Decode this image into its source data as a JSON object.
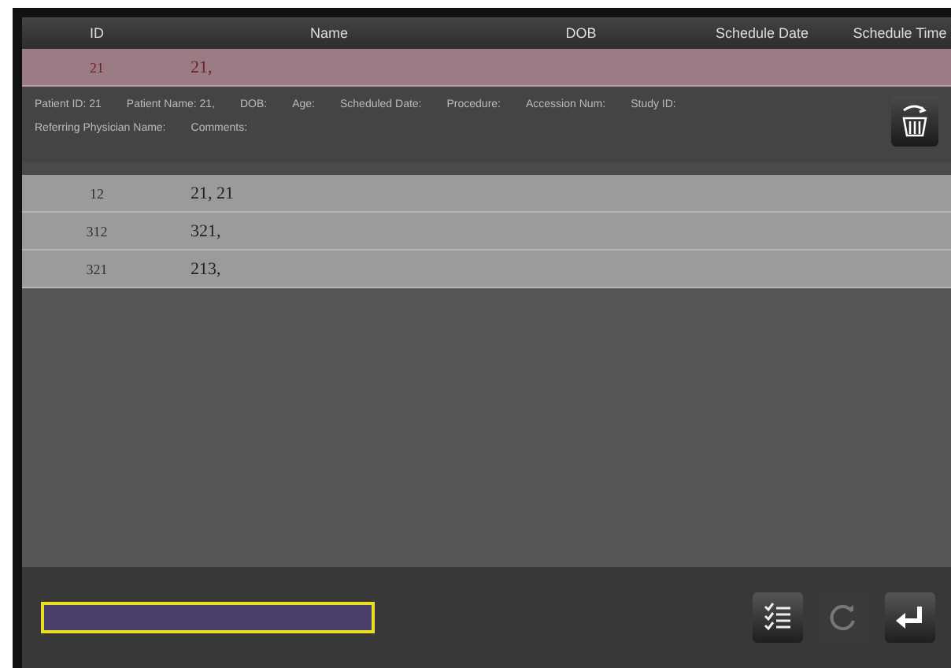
{
  "table": {
    "columns": [
      "ID",
      "Name",
      "DOB",
      "Schedule Date",
      "Schedule Time"
    ],
    "rows": [
      {
        "cells": [
          "21",
          "21,"
        ],
        "selected": true,
        "details": [
          "Patient ID: 21",
          "Patient Name: 21,",
          "DOB:",
          "Age:",
          "Scheduled Date:",
          "Procedure:",
          "Accession Num:",
          "Study ID:",
          "Referring Physician Name:",
          "Comments:"
        ]
      },
      {
        "cells": [
          "12",
          "21, 21"
        ],
        "selected": false
      },
      {
        "cells": [
          "312",
          "321,"
        ],
        "selected": false
      },
      {
        "cells": [
          "321",
          "213,"
        ],
        "selected": false
      }
    ]
  },
  "search": {
    "focused": true
  }
}
